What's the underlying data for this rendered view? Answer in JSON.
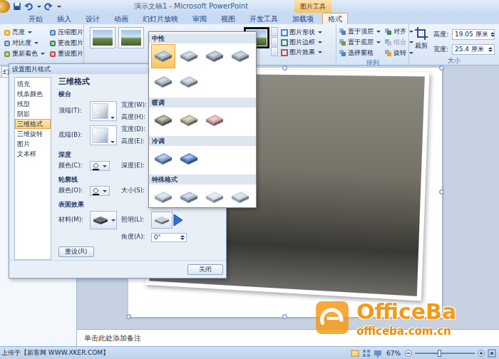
{
  "window": {
    "title": "演示文稿1 - Microsoft PowerPoint",
    "context_tab": "图片工具"
  },
  "tabs": [
    {
      "label": "开始",
      "selected": false
    },
    {
      "label": "插入",
      "selected": false
    },
    {
      "label": "设计",
      "selected": false
    },
    {
      "label": "动画",
      "selected": false
    },
    {
      "label": "幻灯片放映",
      "selected": false
    },
    {
      "label": "审阅",
      "selected": false
    },
    {
      "label": "视图",
      "selected": false
    },
    {
      "label": "开发工具",
      "selected": false
    },
    {
      "label": "加载项",
      "selected": false
    },
    {
      "label": "格式",
      "selected": true
    }
  ],
  "ribbon": {
    "adjust": [
      {
        "label": "亮度",
        "dropdown": true
      },
      {
        "label": "对比度",
        "dropdown": true
      },
      {
        "label": "重新着色",
        "dropdown": true
      },
      {
        "label": "压缩图片",
        "dropdown": false
      },
      {
        "label": "更改图片",
        "dropdown": false
      },
      {
        "label": "重设图片",
        "dropdown": false
      }
    ],
    "styles": [
      {
        "kind": "landscape",
        "selected": false
      },
      {
        "kind": "landscape",
        "selected": false
      },
      {
        "kind": "dark-frame",
        "selected": false
      }
    ],
    "picture_options": [
      {
        "label": "图片形状",
        "dropdown": true
      },
      {
        "label": "图片边框",
        "dropdown": true
      },
      {
        "label": "图片效果",
        "dropdown": true
      }
    ],
    "arrange": {
      "label": "排列",
      "items": [
        {
          "label": "置于顶层",
          "dropdown": true,
          "disabled": false
        },
        {
          "label": "置于底层",
          "dropdown": true,
          "disabled": false
        },
        {
          "label": "选择窗格",
          "dropdown": false,
          "disabled": false
        },
        {
          "label": "对齐",
          "dropdown": true,
          "disabled": false
        },
        {
          "label": "组合",
          "dropdown": true,
          "disabled": true
        },
        {
          "label": "旋转",
          "dropdown": true,
          "disabled": false
        }
      ]
    },
    "size": {
      "label": "大小",
      "crop": "裁剪",
      "fields": [
        {
          "label": "高度:",
          "value": "19.05 厘米"
        },
        {
          "label": "宽度:",
          "value": "25.4 厘米"
        }
      ]
    }
  },
  "dialog": {
    "title": "设置图片格式",
    "nav": [
      {
        "label": "填充",
        "selected": false
      },
      {
        "label": "线条颜色",
        "selected": false
      },
      {
        "label": "线型",
        "selected": false
      },
      {
        "label": "阴影",
        "selected": false
      },
      {
        "label": "三维格式",
        "selected": true
      },
      {
        "label": "三维旋转",
        "selected": false
      },
      {
        "label": "图片",
        "selected": false
      },
      {
        "label": "文本框",
        "selected": false
      }
    ],
    "heading": "三维格式",
    "bevel": {
      "label": "棱台",
      "rows": [
        {
          "label": "顶端(T):",
          "width": "宽度(W):",
          "height": "高度(H):"
        },
        {
          "label": "底端(B):",
          "width": "宽度(D):",
          "height": "高度(E):"
        }
      ]
    },
    "depth": {
      "label": "深度",
      "color": "颜色(C):",
      "size": "深度(E):"
    },
    "contour": {
      "label": "轮廓线",
      "color": "颜色(O):",
      "size": "大小(S):"
    },
    "surface": {
      "label": "表面效果",
      "material": "材料(M):",
      "lighting": "照明(L):",
      "angle": "角度(A):",
      "angle_value": "0°"
    },
    "reset": "重设(R)",
    "close": "关闭"
  },
  "lighting_gallery": {
    "sections": [
      {
        "label": "中性",
        "items": [
          {
            "color": "#a7b3c3",
            "selected": true
          },
          {
            "color": "#b2bdcb",
            "selected": false
          },
          {
            "color": "#9eabbd",
            "selected": false
          },
          {
            "color": "#a9b6c6",
            "selected": false
          },
          {
            "color": "#aab5c4",
            "selected": false
          },
          {
            "color": "#b6c1cf",
            "selected": false
          }
        ]
      },
      {
        "label": "暖调",
        "items": [
          {
            "color": "#8c917a",
            "selected": false
          },
          {
            "color": "#b8b29a",
            "selected": false
          },
          {
            "color": "#d9a3a3",
            "selected": false
          }
        ]
      },
      {
        "label": "冷调",
        "items": [
          {
            "color": "#7fa3d6",
            "selected": false
          },
          {
            "color": "#5e8dcc",
            "selected": false
          }
        ]
      },
      {
        "label": "特殊格式",
        "items": [
          {
            "color": "#c5d2e3",
            "selected": false
          },
          {
            "color": "#a9bcd6",
            "selected": false
          },
          {
            "color": "#d3dce9",
            "selected": false
          },
          {
            "color": "#c9d4e4",
            "selected": false
          }
        ]
      }
    ]
  },
  "slides_panel": {
    "tab": "幻"
  },
  "notes": {
    "placeholder": "单击此处添加备注"
  },
  "status_bar": {
    "zoom": "67%",
    "zoom_level": 0.4
  },
  "watermarks": {
    "upload": "上传于【新客网 WWW.XKER.COM】",
    "brand": "OfficeBa",
    "url": "officeba.com.cn"
  }
}
